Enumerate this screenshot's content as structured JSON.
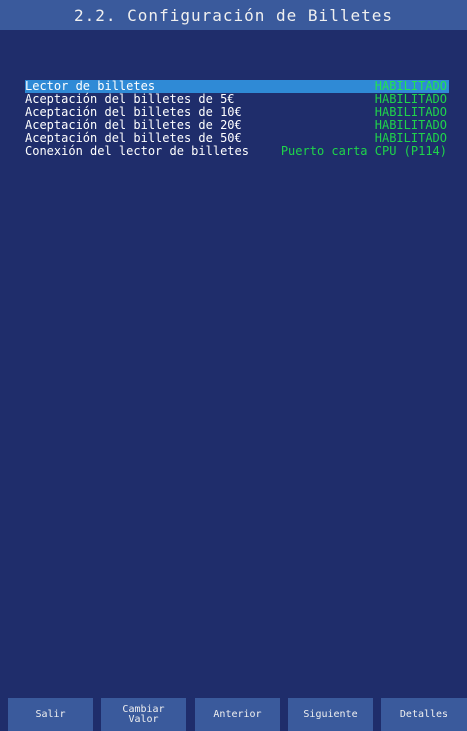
{
  "header": {
    "title": "2.2. Configuración de Billetes"
  },
  "settings": [
    {
      "label": "Lector de billetes",
      "value": "HABILITADO",
      "selected": true
    },
    {
      "label": "Aceptación del billetes de 5€",
      "value": "HABILITADO"
    },
    {
      "label": "Aceptación del billetes de 10€",
      "value": "HABILITADO"
    },
    {
      "label": "Aceptación del billetes de 20€",
      "value": "HABILITADO"
    },
    {
      "label": "Aceptación del billetes de 50€",
      "value": "HABILITADO"
    },
    {
      "label": "Conexión del lector de billetes",
      "value": "Puerto carta CPU (P114)"
    }
  ],
  "footer": {
    "salir": "Salir",
    "cambiar_line1": "Cambiar",
    "cambiar_line2": "Valor",
    "anterior": "Anterior",
    "siguiente": "Siguiente",
    "detalles": "Detalles"
  },
  "colors": {
    "background": "#1f2d6b",
    "bar": "#3a5a9c",
    "selection": "#2f8ad6",
    "value_green": "#1fd44a"
  }
}
